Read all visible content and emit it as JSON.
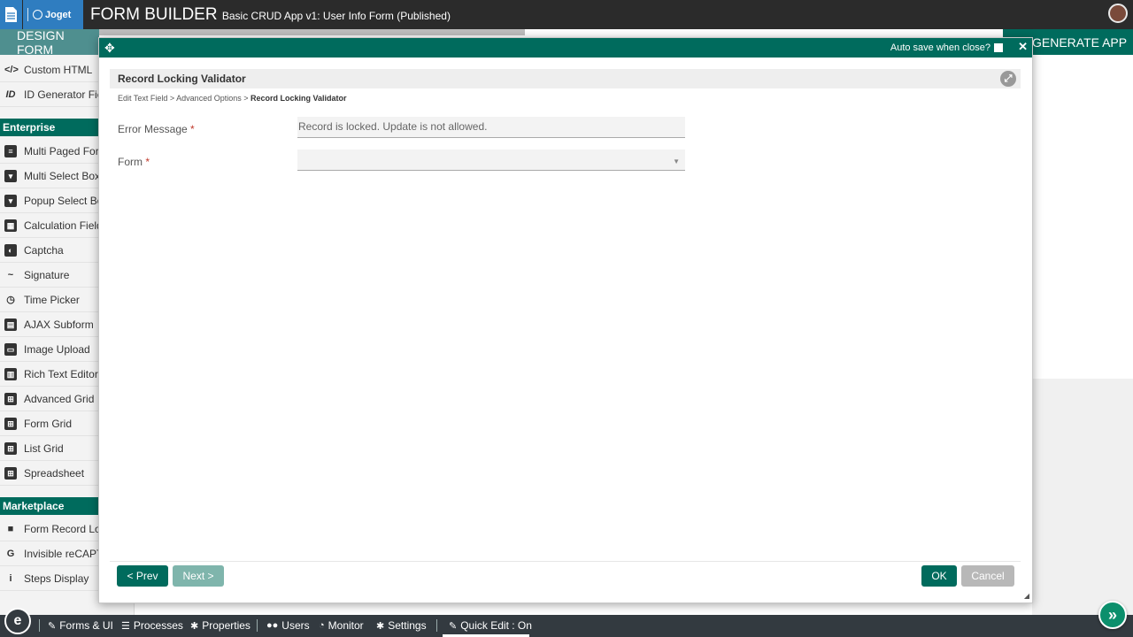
{
  "header": {
    "brand": "Joget",
    "title": "FORM BUILDER",
    "subtitle": "Basic CRUD App v1: User Info Form (Published)"
  },
  "builder": {
    "design_tab": "DESIGN FORM",
    "generate_tab": "GENERATE APP"
  },
  "palette": {
    "top_items": [
      {
        "label": "Custom HTML",
        "icon": "code-icon"
      },
      {
        "label": "ID Generator Field",
        "icon": "id-icon"
      }
    ],
    "sections": [
      {
        "title": "Enterprise",
        "items": [
          {
            "label": "Multi Paged Form",
            "icon": "multi-page-icon"
          },
          {
            "label": "Multi Select Box",
            "icon": "select-box-icon"
          },
          {
            "label": "Popup Select Box",
            "icon": "popup-select-icon"
          },
          {
            "label": "Calculation Field",
            "icon": "calculator-icon"
          },
          {
            "label": "Captcha",
            "icon": "shield-icon"
          },
          {
            "label": "Signature",
            "icon": "signature-icon"
          },
          {
            "label": "Time Picker",
            "icon": "clock-icon"
          },
          {
            "label": "AJAX Subform",
            "icon": "document-icon"
          },
          {
            "label": "Image Upload",
            "icon": "image-icon"
          },
          {
            "label": "Rich Text Editor",
            "icon": "rich-text-icon"
          },
          {
            "label": "Advanced Grid",
            "icon": "grid-icon"
          },
          {
            "label": "Form Grid",
            "icon": "grid-icon"
          },
          {
            "label": "List Grid",
            "icon": "grid-icon"
          },
          {
            "label": "Spreadsheet",
            "icon": "grid-icon"
          }
        ]
      },
      {
        "title": "Marketplace",
        "items": [
          {
            "label": "Form Record Locking",
            "icon": "lock-icon"
          },
          {
            "label": "Invisible reCAPTCHA",
            "icon": "google-icon"
          },
          {
            "label": "Steps Display",
            "icon": "info-icon"
          }
        ]
      }
    ]
  },
  "dialog": {
    "autosave_label": "Auto save when close?",
    "section_title": "Record Locking Validator",
    "breadcrumb": {
      "step1": "Edit Text Field",
      "sep": ">",
      "step2": "Advanced Options",
      "current": "Record Locking Validator"
    },
    "fields": {
      "error_message": {
        "label": "Error Message",
        "required_mark": "*",
        "value": "Record is locked. Update is not allowed."
      },
      "form": {
        "label": "Form",
        "required_mark": "*",
        "value": ""
      }
    },
    "buttons": {
      "prev": "< Prev",
      "next": "Next >",
      "ok": "OK",
      "cancel": "Cancel"
    }
  },
  "bottombar": {
    "forms_ui": "Forms & UI",
    "processes": "Processes",
    "properties": "Properties",
    "users": "Users",
    "monitor": "Monitor",
    "settings": "Settings",
    "quick_edit": "Quick Edit : On"
  },
  "colors": {
    "primary": "#006b5d",
    "brand_blue": "#2f7dc0",
    "header_dark": "#2b2b2b",
    "bottombar": "#333a40",
    "required": "#c0392b"
  }
}
